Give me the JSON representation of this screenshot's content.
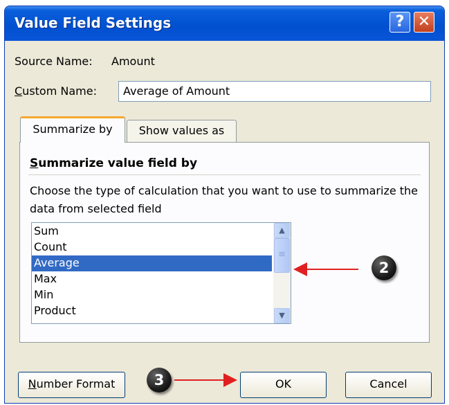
{
  "window": {
    "title": "Value Field Settings",
    "help_glyph": "?",
    "close_glyph": "✕",
    "title_bar_color": "#0054e3"
  },
  "source_name": {
    "label": "Source Name:",
    "value": "Amount"
  },
  "custom_name": {
    "label_accel": "C",
    "label_rest": "ustom Name:",
    "value": "Average of Amount"
  },
  "tabs": [
    {
      "label": "Summarize by",
      "active": true
    },
    {
      "label": "Show values as",
      "active": false
    }
  ],
  "summarize": {
    "heading_accel": "S",
    "heading_rest": "ummarize value field by",
    "description": "Choose the type of calculation that you want to use to summarize the data from selected field",
    "items": [
      "Sum",
      "Count",
      "Average",
      "Max",
      "Min",
      "Product"
    ],
    "selected": "Average",
    "selection_color": "#316ac5"
  },
  "scroll": {
    "up_glyph": "▲",
    "down_glyph": "▼",
    "thumb_glyph": "≡"
  },
  "buttons": {
    "number_format_accel": "N",
    "number_format_rest": "umber Format",
    "ok": "OK",
    "cancel": "Cancel"
  },
  "callouts": {
    "two": "2",
    "three": "3",
    "arrow_color": "#e02020"
  }
}
